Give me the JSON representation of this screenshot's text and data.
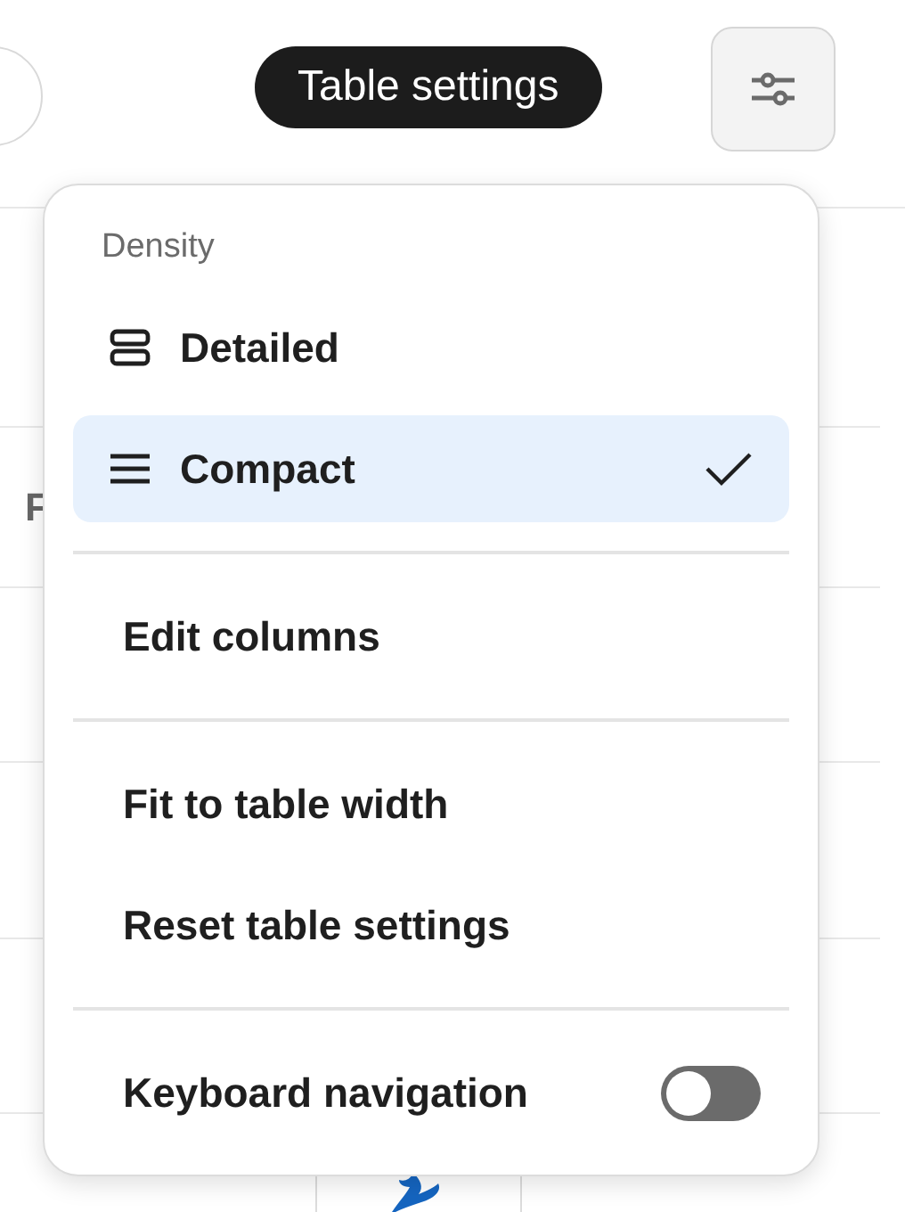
{
  "toolbar": {
    "tooltip": "Table settings"
  },
  "table": {
    "header_fragment": "F"
  },
  "menu": {
    "section_title": "Density",
    "density_options": [
      {
        "label": "Detailed",
        "kind": "detailed",
        "selected": false
      },
      {
        "label": "Compact",
        "kind": "compact",
        "selected": true
      }
    ],
    "action_groups": [
      [
        {
          "label": "Edit columns"
        }
      ],
      [
        {
          "label": "Fit to table width"
        },
        {
          "label": "Reset table settings"
        }
      ]
    ],
    "toggle": {
      "label": "Keyboard navigation",
      "on": false
    }
  }
}
